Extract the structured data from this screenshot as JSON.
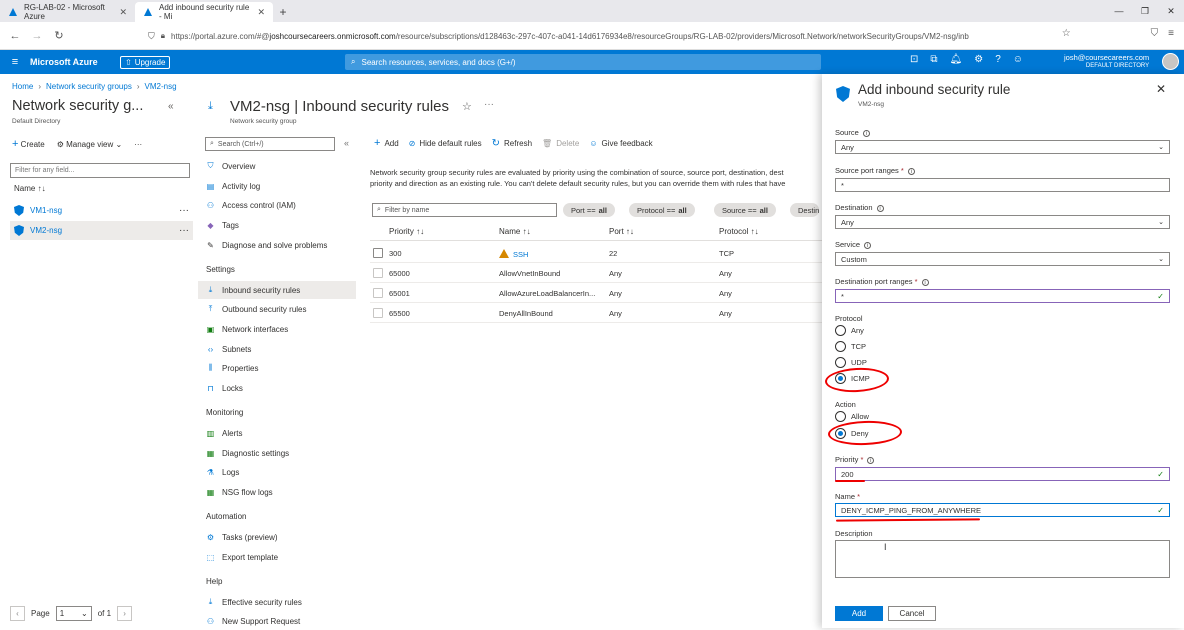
{
  "browser": {
    "tabs": [
      {
        "label": "RG-LAB-02 - Microsoft Azure",
        "active": false
      },
      {
        "label": "Add inbound security rule - Mi",
        "active": true
      }
    ],
    "url_prefix": "https://portal.azure.com/#@",
    "url_domain": "joshcoursecareers.onmicrosoft.com",
    "url_path": "/resource/subscriptions/d128463c-297c-407c-a041-14d6176934e8/resourceGroups/RG-LAB-02/providers/Microsoft.Network/networkSecurityGroups/VM2-nsg/inb"
  },
  "topbar": {
    "brand": "Microsoft Azure",
    "upgrade": "Upgrade",
    "search_placeholder": "Search resources, services, and docs (G+/)",
    "account_email": "josh@coursecareers.com",
    "account_dir": "DEFAULT DIRECTORY"
  },
  "breadcrumb": [
    "Home",
    "Network security groups",
    "VM2-nsg"
  ],
  "left_pane": {
    "title": "Network security g...",
    "subtitle": "Default Directory",
    "create": "Create",
    "manage_view": "Manage view",
    "filter_placeholder": "Filter for any field...",
    "col_name": "Name ↑↓",
    "items": [
      "VM1-nsg",
      "VM2-nsg"
    ],
    "page_label": "Page",
    "page_value": "1",
    "of_label": "of 1"
  },
  "resource": {
    "title": "VM2-nsg | Inbound security rules",
    "subtitle": "Network security group",
    "search_placeholder": "Search (Ctrl+/)",
    "menu_top": [
      "Overview",
      "Activity log",
      "Access control (IAM)",
      "Tags",
      "Diagnose and solve problems"
    ],
    "sections": [
      {
        "title": "Settings",
        "items": [
          "Inbound security rules",
          "Outbound security rules",
          "Network interfaces",
          "Subnets",
          "Properties",
          "Locks"
        ]
      },
      {
        "title": "Monitoring",
        "items": [
          "Alerts",
          "Diagnostic settings",
          "Logs",
          "NSG flow logs"
        ]
      },
      {
        "title": "Automation",
        "items": [
          "Tasks (preview)",
          "Export template"
        ]
      },
      {
        "title": "Help",
        "items": [
          "Effective security rules",
          "New Support Request"
        ]
      }
    ]
  },
  "main": {
    "cmd_add": "Add",
    "cmd_hide": "Hide default rules",
    "cmd_refresh": "Refresh",
    "cmd_delete": "Delete",
    "cmd_feedback": "Give feedback",
    "desc_line1": "Network security group security rules are evaluated by priority using the combination of source, source port, destination, dest",
    "desc_line2": "priority and direction as an existing rule. You can't delete default security rules, but you can override them with rules that have",
    "filter_placeholder": "Filter by name",
    "pills": [
      {
        "label": "Port ==",
        "value": "all"
      },
      {
        "label": "Protocol ==",
        "value": "all"
      },
      {
        "label": "Source ==",
        "value": "all"
      },
      {
        "label": "Destin",
        "value": ""
      }
    ],
    "columns": [
      "Priority ↑↓",
      "Name ↑↓",
      "Port ↑↓",
      "Protocol ↑↓"
    ],
    "rows": [
      {
        "priority": "300",
        "name": "SSH",
        "port": "22",
        "protocol": "TCP"
      },
      {
        "priority": "65000",
        "name": "AllowVnetInBound",
        "port": "Any",
        "protocol": "Any"
      },
      {
        "priority": "65001",
        "name": "AllowAzureLoadBalancerIn...",
        "port": "Any",
        "protocol": "Any"
      },
      {
        "priority": "65500",
        "name": "DenyAllInBound",
        "port": "Any",
        "protocol": "Any"
      }
    ]
  },
  "blade": {
    "title": "Add inbound security rule",
    "subtitle": "VM2-nsg",
    "source_label": "Source",
    "source_value": "Any",
    "src_ports_label": "Source port ranges",
    "src_ports_value": "*",
    "dest_label": "Destination",
    "dest_value": "Any",
    "service_label": "Service",
    "service_value": "Custom",
    "dest_ports_label": "Destination port ranges",
    "dest_ports_value": "*",
    "protocol_label": "Protocol",
    "protocols": [
      "Any",
      "TCP",
      "UDP",
      "ICMP"
    ],
    "protocol_selected": "ICMP",
    "action_label": "Action",
    "actions": [
      "Allow",
      "Deny"
    ],
    "action_selected": "Deny",
    "priority_label": "Priority",
    "priority_value": "200",
    "name_label": "Name",
    "name_value": "DENY_ICMP_PING_FROM_ANYWHERE",
    "description_label": "Description",
    "add_button": "Add",
    "cancel_button": "Cancel",
    "required_mark": "*"
  }
}
